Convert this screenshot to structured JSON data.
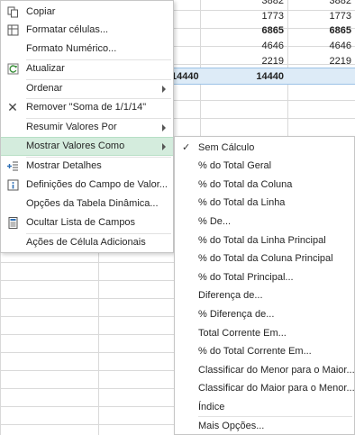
{
  "sheet": {
    "rows": [
      {
        "col1": "3882",
        "col2": "3882",
        "bold": false
      },
      {
        "col1": "1773",
        "col2": "1773",
        "bold": false
      },
      {
        "col1": "6865",
        "col2": "6865",
        "bold": true
      },
      {
        "col1": "4646",
        "col2": "4646",
        "bold": false
      },
      {
        "col1": "2219",
        "col2": "2219",
        "bold": false
      },
      {
        "col1": "14440",
        "col2": "14440",
        "bold": true
      }
    ]
  },
  "context_menu": {
    "items": [
      {
        "label": "Copiar",
        "icon": "copy-icon"
      },
      {
        "label": "Formatar células...",
        "icon": "format-cells-icon"
      },
      {
        "label": "Formato Numérico...",
        "icon": ""
      },
      {
        "label": "Atualizar",
        "icon": "refresh-icon"
      },
      {
        "label": "Ordenar",
        "icon": ""
      },
      {
        "label": "Remover \"Soma de 1/1/14\"",
        "icon": "remove-x-icon"
      },
      {
        "label": "Resumir Valores Por",
        "icon": ""
      },
      {
        "label": "Mostrar Valores Como",
        "icon": ""
      },
      {
        "label": "Mostrar Detalhes",
        "icon": "show-details-icon"
      },
      {
        "label": "Definições do Campo de Valor...",
        "icon": "field-settings-icon"
      },
      {
        "label": "Opções da Tabela Dinâmica...",
        "icon": ""
      },
      {
        "label": "Ocultar Lista de Campos",
        "icon": "field-list-icon"
      },
      {
        "label": "Ações de Célula Adicionais",
        "icon": ""
      }
    ]
  },
  "submenu": {
    "items": [
      {
        "label": "Sem Cálculo",
        "checked": true
      },
      {
        "label": "% do Total Geral",
        "checked": false
      },
      {
        "label": "% do Total da Coluna",
        "checked": false
      },
      {
        "label": "% do Total da Linha",
        "checked": false
      },
      {
        "label": "% De...",
        "checked": false
      },
      {
        "label": "% do Total da Linha Principal",
        "checked": false
      },
      {
        "label": "% do Total da Coluna Principal",
        "checked": false
      },
      {
        "label": "% do Total Principal...",
        "checked": false
      },
      {
        "label": "Diferença de...",
        "checked": false
      },
      {
        "label": "% Diferença de...",
        "checked": false
      },
      {
        "label": "Total Corrente Em...",
        "checked": false
      },
      {
        "label": "% do Total Corrente Em...",
        "checked": false
      },
      {
        "label": "Classificar do Menor para o Maior...",
        "checked": false
      },
      {
        "label": "Classificar do Maior para o Menor...",
        "checked": false
      },
      {
        "label": "Índice",
        "checked": false
      },
      {
        "label": "Mais Opções...",
        "checked": false
      }
    ]
  },
  "colors": {
    "highlight": "#d4ecdd",
    "total_row": "#ddebf7",
    "refresh_icon": "#3a8f3a",
    "info_icon": "#2e6fb5"
  }
}
